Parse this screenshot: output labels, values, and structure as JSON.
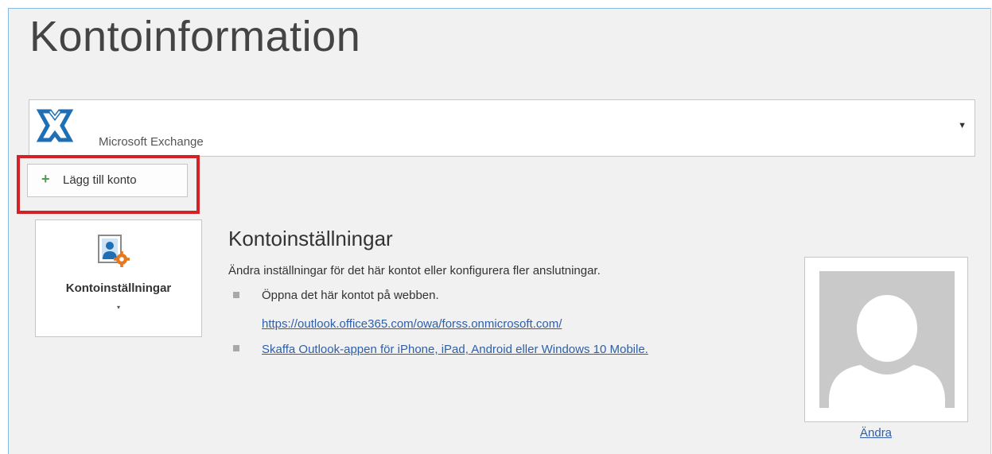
{
  "page": {
    "title": "Kontoinformation"
  },
  "account_selector": {
    "account_name": "Microsoft Exchange",
    "icon": "exchange-icon",
    "dropdown_icon": "triangle-down"
  },
  "add_account": {
    "label": "Lägg till konto",
    "icon": "plus-icon",
    "highlight_color": "#d42027"
  },
  "settings_tile": {
    "label": "Kontoinställningar",
    "icon": "account-settings-icon",
    "chevron": "▾"
  },
  "account_settings": {
    "title": "Kontoinställningar",
    "description": "Ändra inställningar för det här kontot eller konfigurera fler anslutningar.",
    "items": [
      {
        "text": "Öppna det här kontot på webben.",
        "link": "https://outlook.office365.com/owa/forss.onmicrosoft.com/"
      },
      {
        "link": "Skaffa Outlook-appen för iPhone, iPad, Android eller Windows 10 Mobile."
      }
    ]
  },
  "profile": {
    "photo": "default-avatar",
    "change_label": "Ändra"
  },
  "colors": {
    "link": "#2e5fa8",
    "accent_blue": "#1f6fb5",
    "plus_green": "#4e9a55",
    "background": "#f1f1f1"
  }
}
